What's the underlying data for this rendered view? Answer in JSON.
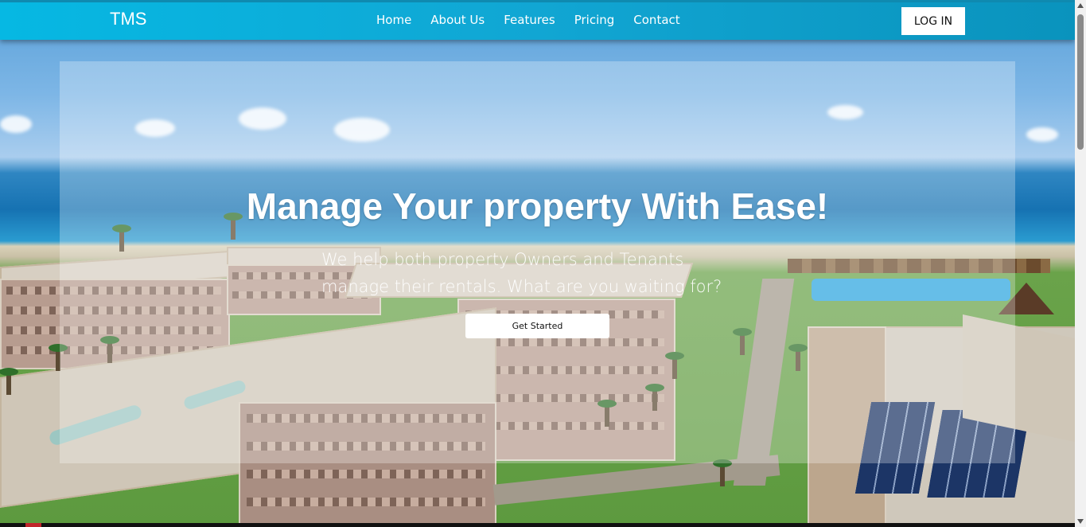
{
  "brand": "TMS",
  "nav": {
    "items": [
      "Home",
      "About Us",
      "Features",
      "Pricing",
      "Contact"
    ],
    "login_label": "LOG IN"
  },
  "hero": {
    "headline": "Manage Your property With Ease!",
    "subtext_line1": "We help both property Owners and Tenants",
    "subtext_line2": "manage their rentals. What are you waiting for?",
    "cta_label": "Get Started"
  },
  "colors": {
    "navbar_start": "#06b8e3",
    "navbar_end": "#0a93bd",
    "text_on_hero": "#ffffff"
  }
}
